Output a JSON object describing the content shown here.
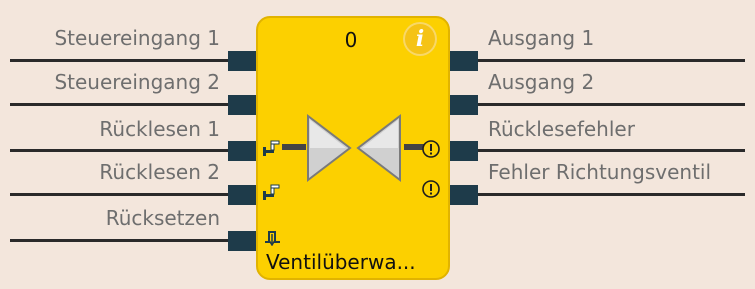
{
  "block": {
    "count": "0",
    "title": "Ventilüberwa...",
    "info_icon": "i",
    "fill_color": "#fcd000",
    "port_color": "#1e3b4a"
  },
  "inputs": [
    {
      "label": "Steuereingang 1"
    },
    {
      "label": "Steuereingang 2"
    },
    {
      "label": "Rücklesen 1"
    },
    {
      "label": "Rücklesen 2"
    },
    {
      "label": "Rücksetzen"
    }
  ],
  "outputs": [
    {
      "label": "Ausgang 1"
    },
    {
      "label": "Ausgang 2"
    },
    {
      "label": "Rücklesefehler"
    },
    {
      "label": "Fehler Richtungsventil"
    }
  ],
  "icons": {
    "readback_1": "readback-pin-icon",
    "readback_2": "readback-pin-icon",
    "reset": "reset-pulse-icon",
    "valve": "valve-icon",
    "error_1": "error-indicator-icon",
    "error_2": "error-indicator-icon"
  }
}
